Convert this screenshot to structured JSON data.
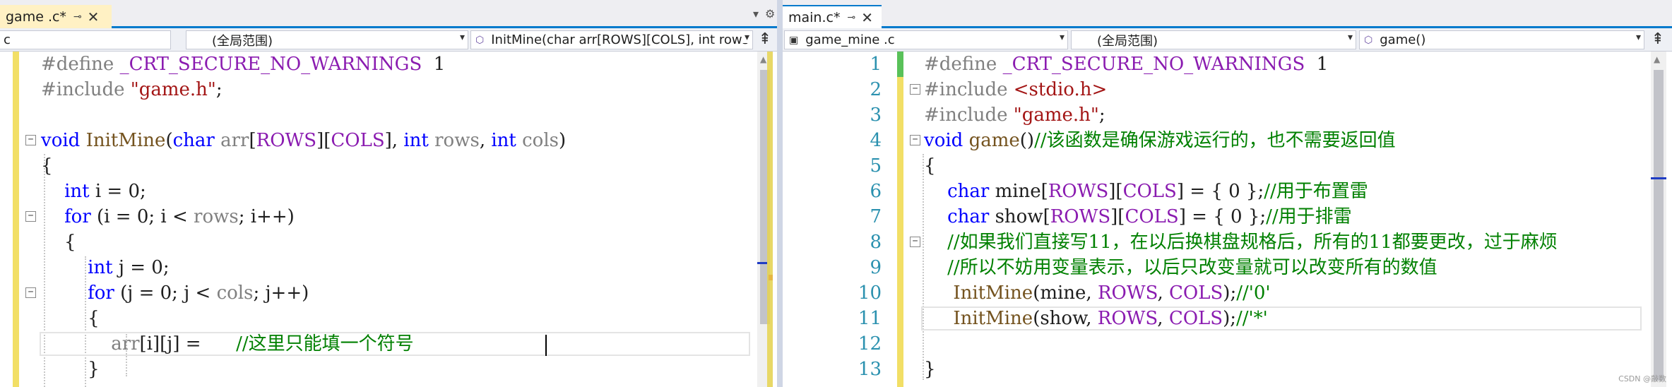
{
  "left_pane": {
    "tab": {
      "title": "game .c*",
      "pin_icon": "pin-icon",
      "close_icon": "close-icon"
    },
    "nav": {
      "project": "c",
      "scope": "(全局范围)",
      "member": "InitMine(char arr[ROWS][COLS], int rows"
    },
    "code": [
      [
        [
          "pp",
          "#define "
        ],
        [
          "mac",
          "_CRT_SECURE_NO_WARNINGS"
        ],
        [
          "",
          "  1"
        ]
      ],
      [
        [
          "pp",
          "#include "
        ],
        [
          "str",
          "\"game.h\""
        ],
        [
          "",
          ";"
        ]
      ],
      [],
      [
        [
          "kw",
          "void "
        ],
        [
          "fn",
          "InitMine"
        ],
        [
          "",
          "("
        ],
        [
          "kw",
          "char "
        ],
        [
          "par",
          "arr"
        ],
        [
          "",
          "["
        ],
        [
          "mac",
          "ROWS"
        ],
        [
          "",
          "]["
        ],
        [
          "mac",
          "COLS"
        ],
        [
          "",
          "], "
        ],
        [
          "kw",
          "int "
        ],
        [
          "par",
          "rows"
        ],
        [
          "",
          ", "
        ],
        [
          "kw",
          "int "
        ],
        [
          "par",
          "cols"
        ],
        [
          "",
          ")"
        ]
      ],
      [
        [
          "",
          "{"
        ]
      ],
      [
        [
          "",
          "    "
        ],
        [
          "kw",
          "int "
        ],
        [
          "",
          "i = 0;"
        ]
      ],
      [
        [
          "",
          "    "
        ],
        [
          "kw",
          "for "
        ],
        [
          "",
          "(i = 0; i < "
        ],
        [
          "par",
          "rows"
        ],
        [
          "",
          "; i++)"
        ]
      ],
      [
        [
          "",
          "    {"
        ]
      ],
      [
        [
          "",
          "        "
        ],
        [
          "kw",
          "int "
        ],
        [
          "",
          "j = 0;"
        ]
      ],
      [
        [
          "",
          "        "
        ],
        [
          "kw",
          "for "
        ],
        [
          "",
          "(j = 0; j < "
        ],
        [
          "par",
          "cols"
        ],
        [
          "",
          "; j++)"
        ]
      ],
      [
        [
          "",
          "        {"
        ]
      ],
      [
        [
          "",
          "            "
        ],
        [
          "par",
          "arr"
        ],
        [
          "",
          "[i][j] =      "
        ],
        [
          "com",
          "//这里只能填一个符号"
        ]
      ],
      [
        [
          "",
          "        }"
        ]
      ]
    ]
  },
  "right_pane": {
    "tab": {
      "title": "main.c*",
      "pin_icon": "pin-icon",
      "close_icon": "close-icon"
    },
    "nav": {
      "project": "game_mine .c",
      "scope": "(全局范围)",
      "member": "game()"
    },
    "line_numbers": [
      "1",
      "2",
      "3",
      "4",
      "5",
      "6",
      "7",
      "8",
      "9",
      "10",
      "11",
      "12",
      "13"
    ],
    "code": [
      [
        [
          "pp",
          "#define "
        ],
        [
          "mac",
          "_CRT_SECURE_NO_WARNINGS"
        ],
        [
          "",
          "  1"
        ]
      ],
      [
        [
          "pp",
          "#include "
        ],
        [
          "str",
          "<stdio.h>"
        ]
      ],
      [
        [
          "pp",
          "#include "
        ],
        [
          "str",
          "\"game.h\""
        ],
        [
          "",
          ";"
        ]
      ],
      [
        [
          "kw",
          "void "
        ],
        [
          "fn",
          "game"
        ],
        [
          "",
          "()"
        ],
        [
          "com",
          "//该函数是确保游戏运行的，也不需要返回值"
        ]
      ],
      [
        [
          "",
          "{"
        ]
      ],
      [
        [
          "",
          "    "
        ],
        [
          "kw",
          "char "
        ],
        [
          "",
          "mine["
        ],
        [
          "mac",
          "ROWS"
        ],
        [
          "",
          "]["
        ],
        [
          "mac",
          "COLS"
        ],
        [
          "",
          "] = { 0 };"
        ],
        [
          "com",
          "//用于布置雷"
        ]
      ],
      [
        [
          "",
          "    "
        ],
        [
          "kw",
          "char "
        ],
        [
          "",
          "show["
        ],
        [
          "mac",
          "ROWS"
        ],
        [
          "",
          "]["
        ],
        [
          "mac",
          "COLS"
        ],
        [
          "",
          "] = { 0 };"
        ],
        [
          "com",
          "//用于排雷"
        ]
      ],
      [
        [
          "",
          "    "
        ],
        [
          "com",
          "//如果我们直接写11，在以后换棋盘规格后，所有的11都要更改，过于麻烦"
        ]
      ],
      [
        [
          "",
          "    "
        ],
        [
          "com",
          "//所以不妨用变量表示，以后只改变量就可以改变所有的数值"
        ]
      ],
      [
        [
          "",
          "     "
        ],
        [
          "fn",
          "InitMine"
        ],
        [
          "",
          "(mine, "
        ],
        [
          "mac",
          "ROWS"
        ],
        [
          "",
          ", "
        ],
        [
          "mac",
          "COLS"
        ],
        [
          "",
          ");"
        ],
        [
          "com",
          "//'0'"
        ]
      ],
      [
        [
          "",
          "     "
        ],
        [
          "fn",
          "InitMine"
        ],
        [
          "",
          "(show, "
        ],
        [
          "mac",
          "ROWS"
        ],
        [
          "",
          ", "
        ],
        [
          "mac",
          "COLS"
        ],
        [
          "",
          ");"
        ],
        [
          "com",
          "//'*'"
        ]
      ],
      [],
      [
        [
          "",
          "}"
        ]
      ]
    ]
  },
  "watermark": "CSDN @敲数",
  "colors": {
    "keyword": "#0000ff",
    "preprocessor": "#808080",
    "macro": "#8a1bb0",
    "string": "#a31515",
    "comment": "#008000",
    "function": "#74531f",
    "accent": "#007acc"
  }
}
